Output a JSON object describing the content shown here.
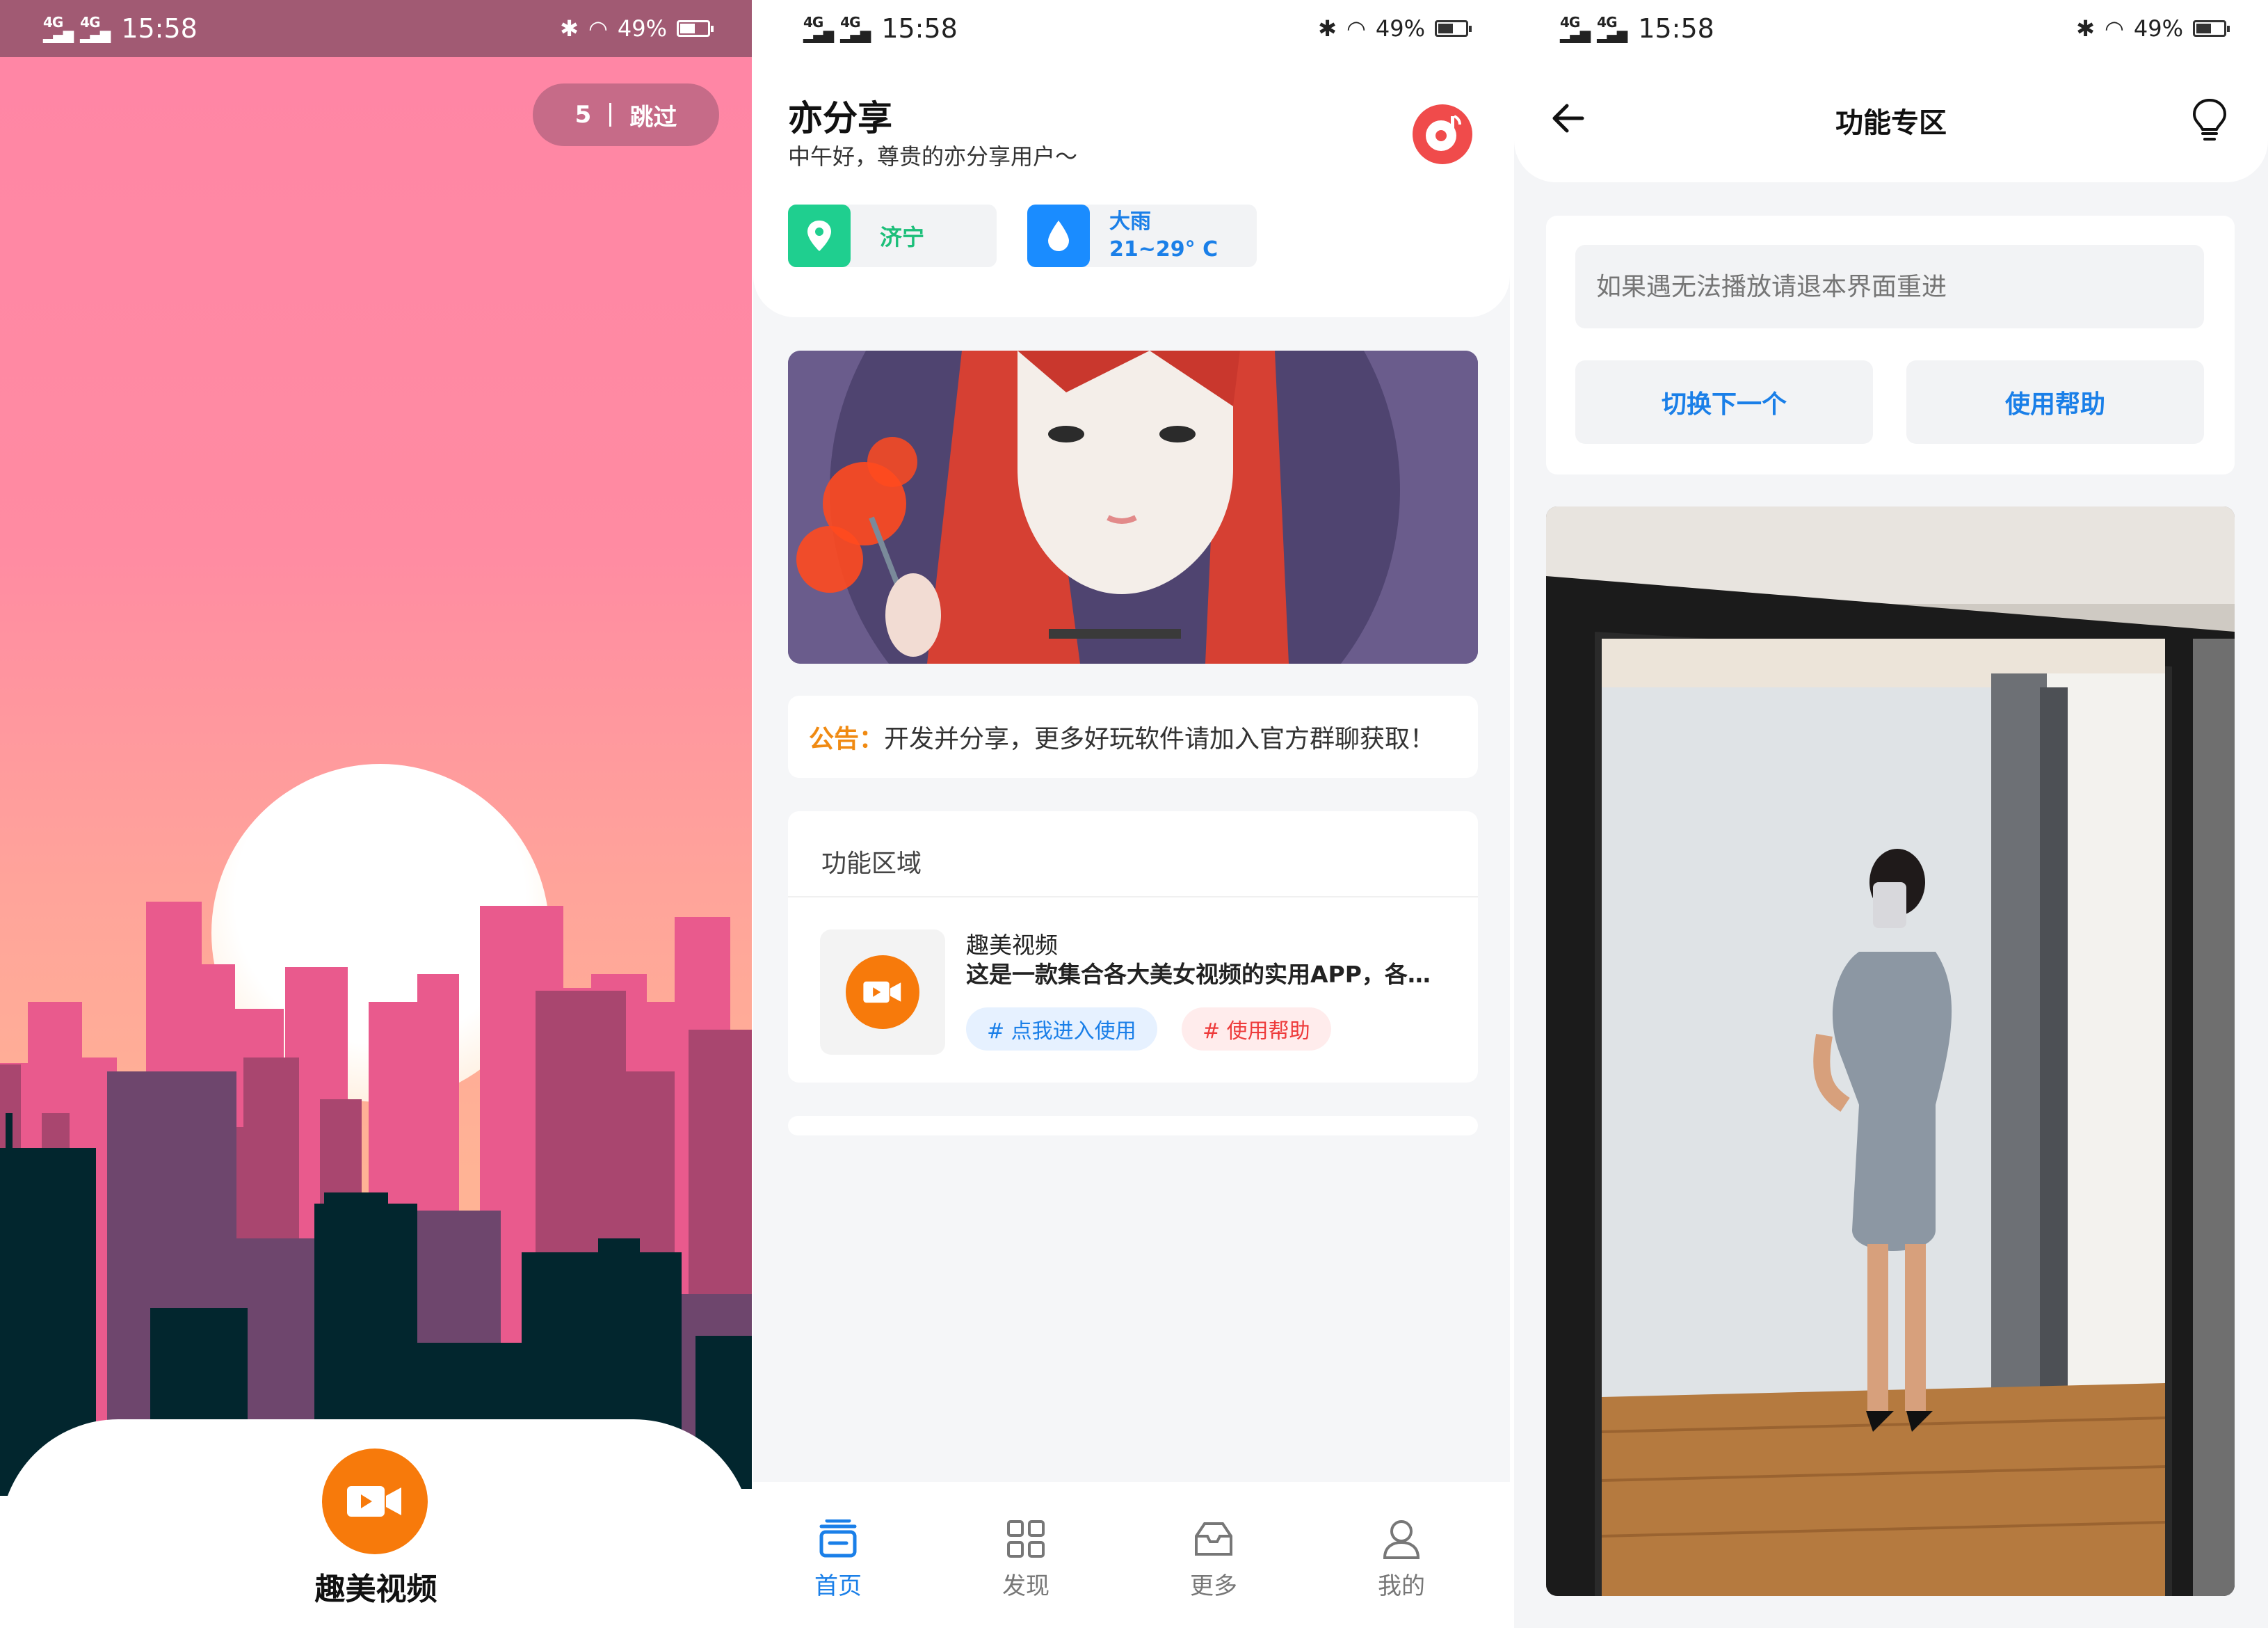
{
  "status": {
    "signal": [
      "4GHD",
      "4GHD"
    ],
    "time": "15:58",
    "battery": "49%",
    "battery_level": 0.49
  },
  "splash": {
    "countdown": "5",
    "skip_label": "跳过",
    "app_name": "趣美视频",
    "colors": {
      "sky_top": "#ff86a5",
      "sky_bottom": "#ffb395",
      "building_pink": "#e95a8d",
      "building_dark": "#02262e",
      "logo": "#f77a0b"
    }
  },
  "home": {
    "title": "亦分享",
    "greeting": "中午好，尊贵的亦分享用户～",
    "location": "济宁",
    "weather": {
      "condition": "大雨",
      "range": "21~29° C"
    },
    "notice": {
      "label": "公告：",
      "text": "开发并分享，更多好玩软件请加入官方群聊获取！"
    },
    "section_title": "功能区域",
    "feature": {
      "name": "趣美视频",
      "desc": "这是一款集合各大美女视频的实用APP，各…",
      "tag_enter": "# 点我进入使用",
      "tag_help": "# 使用帮助"
    },
    "tabs": [
      {
        "label": "首页",
        "icon": "home-icon",
        "active": true
      },
      {
        "label": "发现",
        "icon": "grid-icon",
        "active": false
      },
      {
        "label": "更多",
        "icon": "inbox-icon",
        "active": false
      },
      {
        "label": "我的",
        "icon": "user-icon",
        "active": false
      }
    ],
    "colors": {
      "accent": "#1a7fe8",
      "music": "#f04b4b",
      "location": "#1fcf8f",
      "weather": "#1a8cff",
      "notice": "#f08a12"
    }
  },
  "player": {
    "title": "功能专区",
    "hint_placeholder": "如果遇无法播放请退本界面重进",
    "next_button": "切换下一个",
    "help_button": "使用帮助"
  }
}
